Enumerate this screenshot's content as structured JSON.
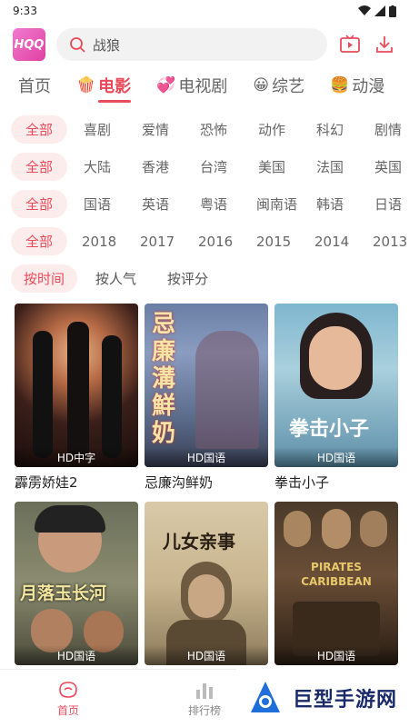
{
  "status": {
    "time": "9:33"
  },
  "header": {
    "logo": "HQQ",
    "search_text": "战狼"
  },
  "nav_tabs": [
    {
      "label": "首页",
      "emoji": ""
    },
    {
      "label": "电影",
      "emoji": "🍿"
    },
    {
      "label": "电视剧",
      "emoji": "💞"
    },
    {
      "label": "综艺",
      "emoji": "😀"
    },
    {
      "label": "动漫",
      "emoji": "🍔"
    }
  ],
  "filters": {
    "genre": [
      "全部",
      "喜剧",
      "爱情",
      "恐怖",
      "动作",
      "科幻",
      "剧情"
    ],
    "region": [
      "全部",
      "大陆",
      "香港",
      "台湾",
      "美国",
      "法国",
      "英国"
    ],
    "language": [
      "全部",
      "国语",
      "英语",
      "粤语",
      "闽南语",
      "韩语",
      "日语"
    ],
    "year": [
      "全部",
      "2018",
      "2017",
      "2016",
      "2015",
      "2014",
      "2013"
    ]
  },
  "sort": [
    "按时间",
    "按人气",
    "按评分"
  ],
  "movies": [
    {
      "title": "霹雳娇娃2",
      "badge": "HD中字",
      "poster_text": ""
    },
    {
      "title": "忌廉沟鲜奶",
      "badge": "HD国语",
      "poster_text": "忌廉溝鮮奶"
    },
    {
      "title": "拳击小子",
      "badge": "HD国语",
      "poster_text": "拳击小子"
    },
    {
      "title": "",
      "badge": "HD国语",
      "poster_text": "月落玉长河"
    },
    {
      "title": "",
      "badge": "HD国语",
      "poster_text": "儿女亲事"
    },
    {
      "title": "",
      "badge": "HD国语",
      "poster_text": "PIRATES CARIBBEAN"
    }
  ],
  "bottom_nav": [
    {
      "label": "首页"
    },
    {
      "label": "排行榜"
    }
  ],
  "watermark": {
    "text": "巨型手游网"
  },
  "colors": {
    "accent": "#e94b5b",
    "chip_bg": "#fdecec"
  }
}
